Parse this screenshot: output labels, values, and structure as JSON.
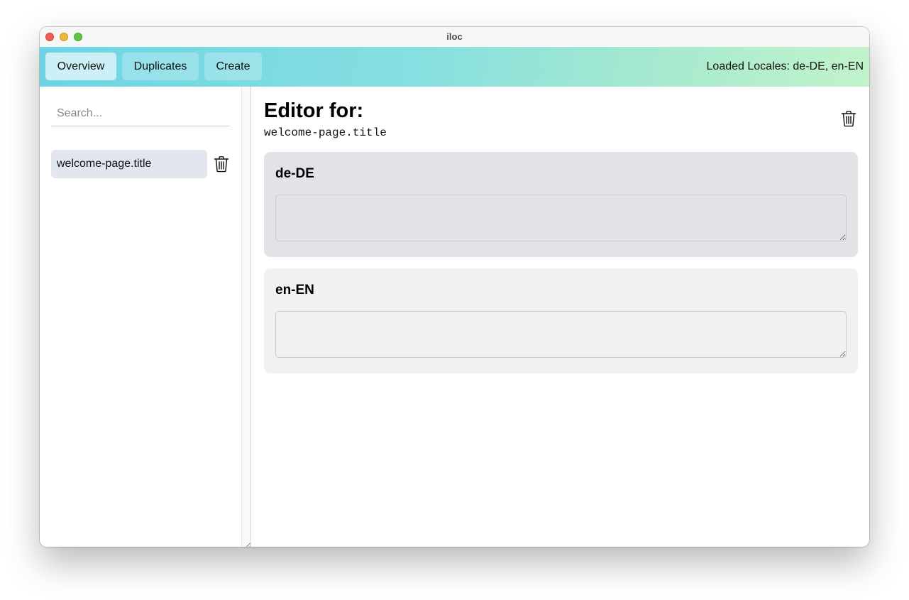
{
  "window": {
    "title": "iloc"
  },
  "toolbar": {
    "tabs": [
      {
        "label": "Overview",
        "active": true
      },
      {
        "label": "Duplicates",
        "active": false
      },
      {
        "label": "Create",
        "active": false
      }
    ],
    "loaded_locales": "Loaded Locales: de-DE, en-EN"
  },
  "sidebar": {
    "search_placeholder": "Search...",
    "search_value": "",
    "keys": [
      {
        "label": "welcome-page.title",
        "selected": true
      }
    ]
  },
  "editor": {
    "heading": "Editor for:",
    "key": "welcome-page.title",
    "locales": [
      {
        "name": "de-DE",
        "value": ""
      },
      {
        "name": "en-EN",
        "value": ""
      }
    ]
  },
  "icons": {
    "trash": "trash-icon",
    "resize_grip": "resize-grip-icon"
  },
  "colors": {
    "toolbar_gradient_start": "#6dd4e4",
    "toolbar_gradient_end": "#c2f3cb",
    "active_tab": "#cdf0f6",
    "selected_key": "#e1e6ef",
    "active_card": "#e2e3e7",
    "inactive_card": "#f1f1f3"
  }
}
